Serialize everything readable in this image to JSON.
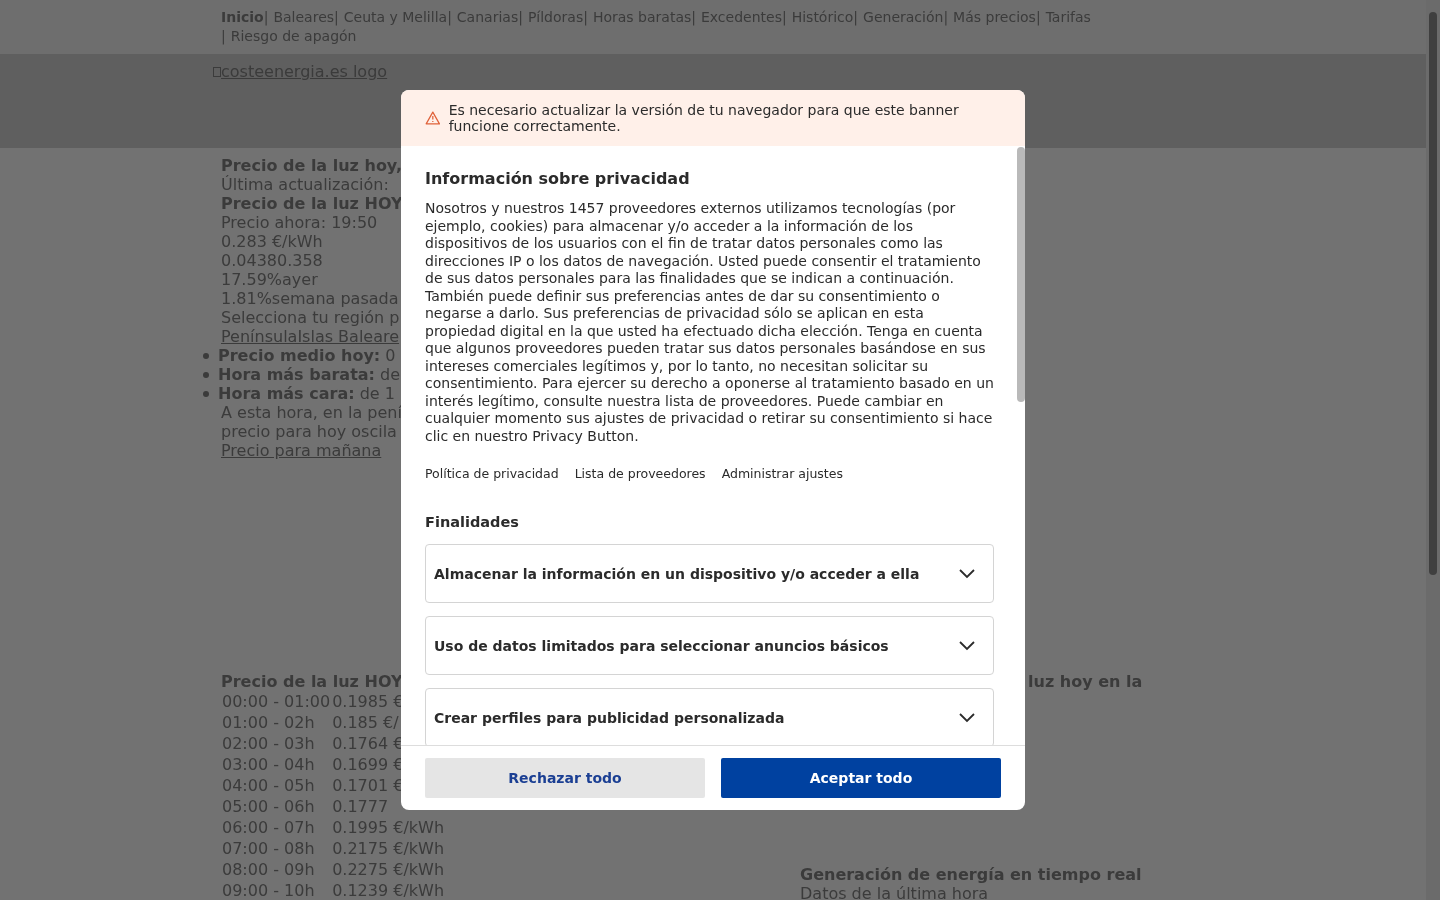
{
  "nav": {
    "rows": [
      [
        {
          "kind": "link",
          "label": "Inicio",
          "selected": true
        },
        {
          "kind": "sep",
          "text": "|"
        },
        {
          "kind": "link",
          "label": "Baleares",
          "selected": false
        },
        {
          "kind": "sep",
          "text": "|"
        },
        {
          "kind": "link",
          "label": "Ceuta y Melilla",
          "selected": false
        },
        {
          "kind": "sep",
          "text": "|"
        },
        {
          "kind": "link",
          "label": "Canarias",
          "selected": false
        },
        {
          "kind": "sep",
          "text": "|"
        },
        {
          "kind": "link",
          "label": "Píldoras",
          "selected": false
        },
        {
          "kind": "sep",
          "text": "|"
        },
        {
          "kind": "link",
          "label": "Horas baratas",
          "selected": false
        },
        {
          "kind": "sep",
          "text": "|"
        },
        {
          "kind": "link",
          "label": "Excedentes",
          "selected": false
        },
        {
          "kind": "sep",
          "text": "|"
        },
        {
          "kind": "link",
          "label": "Histórico",
          "selected": false
        },
        {
          "kind": "sep",
          "text": "|"
        },
        {
          "kind": "link",
          "label": "Generación",
          "selected": false
        },
        {
          "kind": "sep",
          "text": "|"
        },
        {
          "kind": "link",
          "label": "Más precios",
          "selected": false
        },
        {
          "kind": "sep",
          "text": "|"
        },
        {
          "kind": "link",
          "label": "Tarifas",
          "selected": false
        }
      ],
      [
        {
          "kind": "sep",
          "text": "|"
        },
        {
          "kind": "link",
          "label": "Riesgo de apagón",
          "selected": false
        }
      ]
    ]
  },
  "header": {
    "logo_alt": "costeenergia.es logo"
  },
  "summary": [
    {
      "kind": "heading",
      "text": "Precio de la luz hoy,"
    },
    {
      "kind": "text",
      "text": "Última actualización:"
    },
    {
      "kind": "heading",
      "text": "Precio de la luz HOY"
    },
    {
      "kind": "text",
      "text": "Precio ahora: 19:50"
    },
    {
      "kind": "text",
      "text": "0.283 €/kWh"
    },
    {
      "kind": "text",
      "text": "0.04380.358"
    },
    {
      "kind": "text",
      "text": "17.59%ayer"
    },
    {
      "kind": "text",
      "text": "1.81%semana pasada"
    },
    {
      "kind": "text",
      "text": "Selecciona tu región p"
    },
    {
      "kind": "link",
      "text": "PenínsulaIslas Baleare"
    },
    {
      "kind": "bullet",
      "label": "Precio medio hoy:",
      "text": "0"
    },
    {
      "kind": "bullet",
      "label": "Hora más barata:",
      "text": "de"
    },
    {
      "kind": "bullet",
      "label": "Hora más cara:",
      "text": "de 1"
    },
    {
      "kind": "text",
      "text": "A esta hora, en la pení"
    },
    {
      "kind": "text",
      "text": "precio para hoy oscila"
    },
    {
      "kind": "link",
      "text": "Precio para mañana"
    }
  ],
  "hourly": {
    "title": "Precio de la luz HOY",
    "rows": [
      {
        "hours": "00:00 - 01:00",
        "price": "0.1985 €"
      },
      {
        "hours": "01:00 - 02h",
        "price": "0.185 €/"
      },
      {
        "hours": "02:00 - 03h",
        "price": "0.1764 €"
      },
      {
        "hours": "03:00 - 04h",
        "price": "0.1699 €"
      },
      {
        "hours": "04:00 - 05h",
        "price": "0.1701 €"
      },
      {
        "hours": "05:00 - 06h",
        "price": "0.1777"
      },
      {
        "hours": "06:00 - 07h",
        "price": "0.1995 €/kWh"
      },
      {
        "hours": "07:00 - 08h",
        "price": "0.2175 €/kWh"
      },
      {
        "hours": "08:00 - 09h",
        "price": "0.2275 €/kWh"
      },
      {
        "hours": "09:00 - 10h",
        "price": "0.1239 €/kWh"
      }
    ]
  },
  "side": {
    "heading": "luz hoy en la",
    "generation_title": "Generación de energía en tiempo real",
    "generation_subtitle": "Datos de la última hora"
  },
  "consent": {
    "warning": "Es necesario actualizar la versión de tu navegador para que este banner funcione correctamente.",
    "title": "Información sobre privacidad",
    "body": "Nosotros y nuestros 1457 proveedores externos utilizamos tecnologías (por ejemplo, cookies) para almacenar y/o acceder a la información de los dispositivos de los usuarios con el fin de tratar datos personales como las direcciones IP o los datos de navegación. Usted puede consentir el tratamiento de sus datos personales para las finalidades que se indican a continuación. También puede definir sus preferencias antes de dar su consentimiento o negarse a darlo. Sus preferencias de privacidad sólo se aplican en esta propiedad digital en la que usted ha efectuado dicha elección. Tenga en cuenta que algunos proveedores pueden tratar sus datos personales basándose en sus intereses comerciales legítimos y, por lo tanto, no necesitan solicitar su consentimiento. Para ejercer su derecho a oponerse al tratamiento basado en un interés legítimo, consulte nuestra lista de proveedores. Puede cambiar en cualquier momento sus ajustes de privacidad o retirar su consentimiento si hace clic en nuestro Privacy Button.",
    "links": [
      "Política de privacidad",
      "Lista de proveedores",
      "Administrar ajustes"
    ],
    "purposes_title": "Finalidades",
    "purposes": [
      {
        "label": "Almacenar la información en un dispositivo y/o acceder a ella",
        "expanded": false
      },
      {
        "label": "Uso de datos limitados para seleccionar anuncios básicos",
        "expanded": false
      },
      {
        "label": "Crear perfiles para publicidad personalizada",
        "expanded": false
      }
    ],
    "buttons": [
      {
        "kind": "reject",
        "label": "Rechazar todo"
      },
      {
        "kind": "accept",
        "label": "Aceptar todo"
      }
    ]
  }
}
